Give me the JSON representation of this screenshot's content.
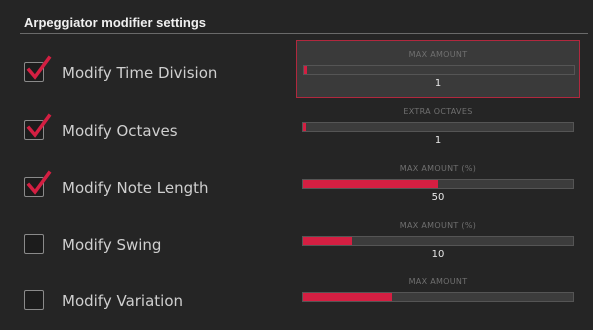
{
  "title": "Arpeggiator modifier settings",
  "colors": {
    "accent": "#d41f42",
    "background": "#252525",
    "selected_border": "#b1283e"
  },
  "rows": [
    {
      "label": "Modify Time Division",
      "checked": true,
      "control_title": "MAX AMOUNT",
      "value": "1",
      "level": 0.01,
      "selected": true
    },
    {
      "label": "Modify Octaves",
      "checked": true,
      "control_title": "EXTRA OCTAVES",
      "value": "1",
      "level": 0.01,
      "selected": false
    },
    {
      "label": "Modify Note Length",
      "checked": true,
      "control_title": "MAX AMOUNT (%)",
      "value": "50",
      "level": 0.5,
      "selected": false
    },
    {
      "label": "Modify Swing",
      "checked": false,
      "control_title": "MAX AMOUNT (%)",
      "value": "10",
      "level": 0.18,
      "selected": false
    },
    {
      "label": "Modify Variation",
      "checked": false,
      "control_title": "MAX AMOUNT",
      "value": "",
      "level": 0.33,
      "selected": false
    }
  ]
}
